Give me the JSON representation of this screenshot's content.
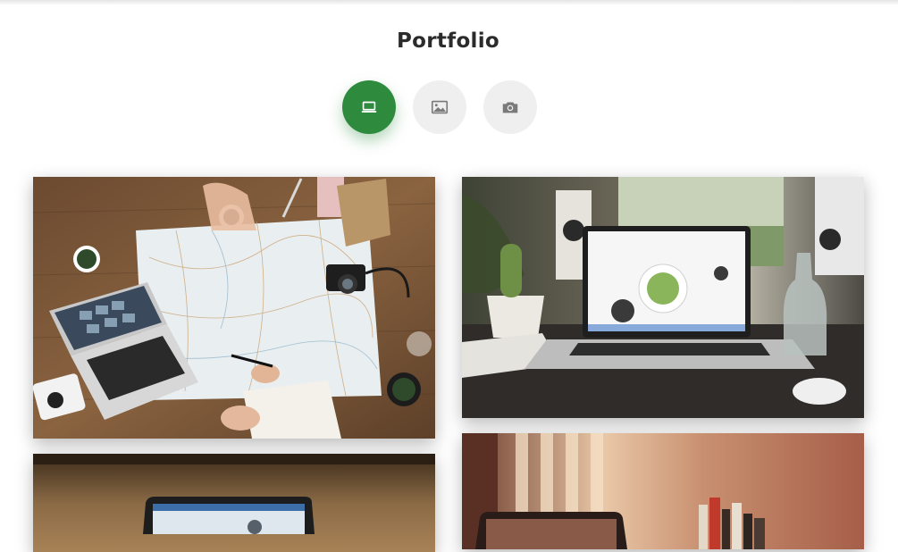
{
  "page": {
    "title": "Portfolio"
  },
  "filters": [
    {
      "name": "laptop",
      "icon": "laptop-icon",
      "active": true
    },
    {
      "name": "image",
      "icon": "image-icon",
      "active": false
    },
    {
      "name": "camera",
      "icon": "camera-icon",
      "active": false
    }
  ],
  "colors": {
    "accent": "#2e8b3e",
    "inactive": "#efefef",
    "icon_inactive": "#7a7a7a"
  },
  "gallery": [
    {
      "subject": "map-travel-desk-photo"
    },
    {
      "subject": "laptop-with-cactus-photo"
    },
    {
      "subject": "laptop-on-wooden-desk-photo"
    },
    {
      "subject": "laptop-in-warm-room-photo"
    }
  ]
}
